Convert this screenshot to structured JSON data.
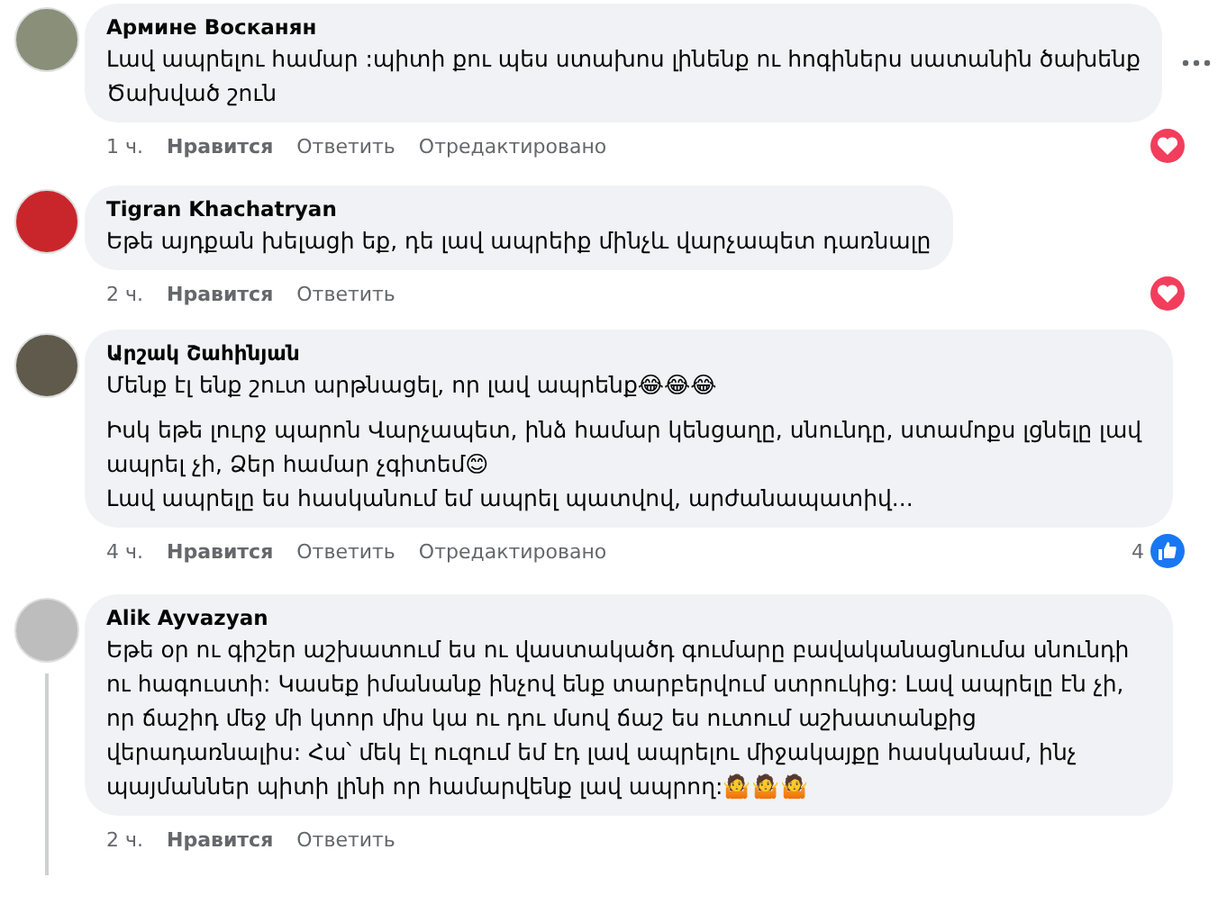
{
  "comments": [
    {
      "author": "Армине Восканян",
      "paragraphs": [
        {
          "lines": [
            "Լավ ապրելու համար :պիտի քու պես ստախոս լինենք ու հոգիներս սատանին ծախենք",
            "Ծախված շուն"
          ]
        }
      ],
      "time": "1 ч.",
      "like": "Нравится",
      "reply": "Ответить",
      "edited": "Отредактировано",
      "reaction": {
        "kind": "heart"
      },
      "has_menu": true,
      "thread_line": false
    },
    {
      "author": "Tigran Khachatryan",
      "paragraphs": [
        {
          "lines": [
            "Եթե այդքան խելացի եք, դե լավ ապրեիք մինչև վարչապետ դառնալը"
          ]
        }
      ],
      "time": "2 ч.",
      "like": "Нравится",
      "reply": "Ответить",
      "reaction": {
        "kind": "heart"
      },
      "has_menu": false,
      "thread_line": false
    },
    {
      "author": "Արշակ Շահինյան",
      "paragraphs": [
        {
          "lines": [
            "Մենք էլ ենք շուտ արթնացել, որ լավ ապրենք😂😂😂"
          ]
        },
        {
          "lines": [
            "Իսկ եթե լուրջ պարոն Վարչապետ, ինձ համար կենցաղը, սնունդը, ստամոքս լցնելը լավ ապրել չի, Ձեր համար չգիտեմ😊",
            "Լավ ապրելը ես հասկանում եմ ապրել պատվով, արժանապատիվ..."
          ]
        }
      ],
      "time": "4 ч.",
      "like": "Нравится",
      "reply": "Ответить",
      "edited": "Отредактировано",
      "reaction": {
        "kind": "like",
        "count": "4"
      },
      "has_menu": false,
      "thread_line": false
    },
    {
      "author": "Alik Ayvazyan",
      "paragraphs": [
        {
          "lines": [
            "Եթե օր ու գիշեր աշխատում ես ու վաստակածդ գումարը բավականացնումա սնունդի ու հագուստի: Կասեք իմանանք ինչով ենք տարբերվում ստրուկից: Լավ ապրելը էն չի, որ ճաշիդ մեջ մի կտոր միս կա ու դու մսով ճաշ ես ուտում աշխատանքից վերադառնալիս: Հա՝ մեկ էլ ուզում եմ էդ լավ ապրելու միջակայքը հասկանամ, ինչ պայմաններ պիտի լինի որ համարվենք լավ ապրող:🤷🤷🤷"
          ]
        }
      ],
      "time": "2 ч.",
      "like": "Нравится",
      "reply": "Ответить",
      "reaction": {
        "kind": "none"
      },
      "has_menu": false,
      "thread_line": true
    }
  ]
}
